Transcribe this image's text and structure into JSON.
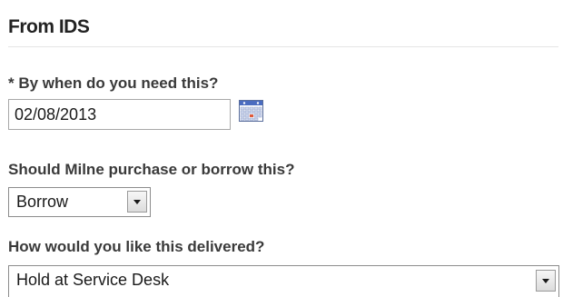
{
  "section": {
    "title": "From IDS"
  },
  "date_field": {
    "label": "* By when do you need this?",
    "value": "02/08/2013",
    "icon": "calendar-icon"
  },
  "purchase_field": {
    "label": "Should Milne purchase or borrow this?",
    "selected": "Borrow"
  },
  "delivery_field": {
    "label": "How would you like this delivered?",
    "selected": "Hold at Service Desk"
  }
}
